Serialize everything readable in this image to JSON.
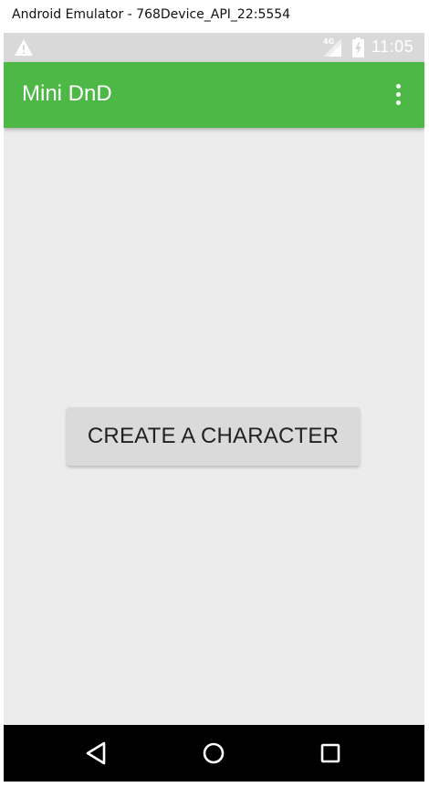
{
  "window": {
    "title": "Android Emulator - 768Device_API_22:5554"
  },
  "status_bar": {
    "network_label": "4G",
    "time": "11:05",
    "icons": [
      "warning-icon",
      "signal-icon",
      "battery-icon"
    ]
  },
  "app_bar": {
    "title": "Mini DnD",
    "color": "#4db845",
    "menu_icon": "overflow-menu-icon"
  },
  "main": {
    "create_button_label": "CREATE A CHARACTER"
  },
  "nav_bar": {
    "buttons": [
      "back-icon",
      "home-icon",
      "recent-apps-icon"
    ]
  }
}
